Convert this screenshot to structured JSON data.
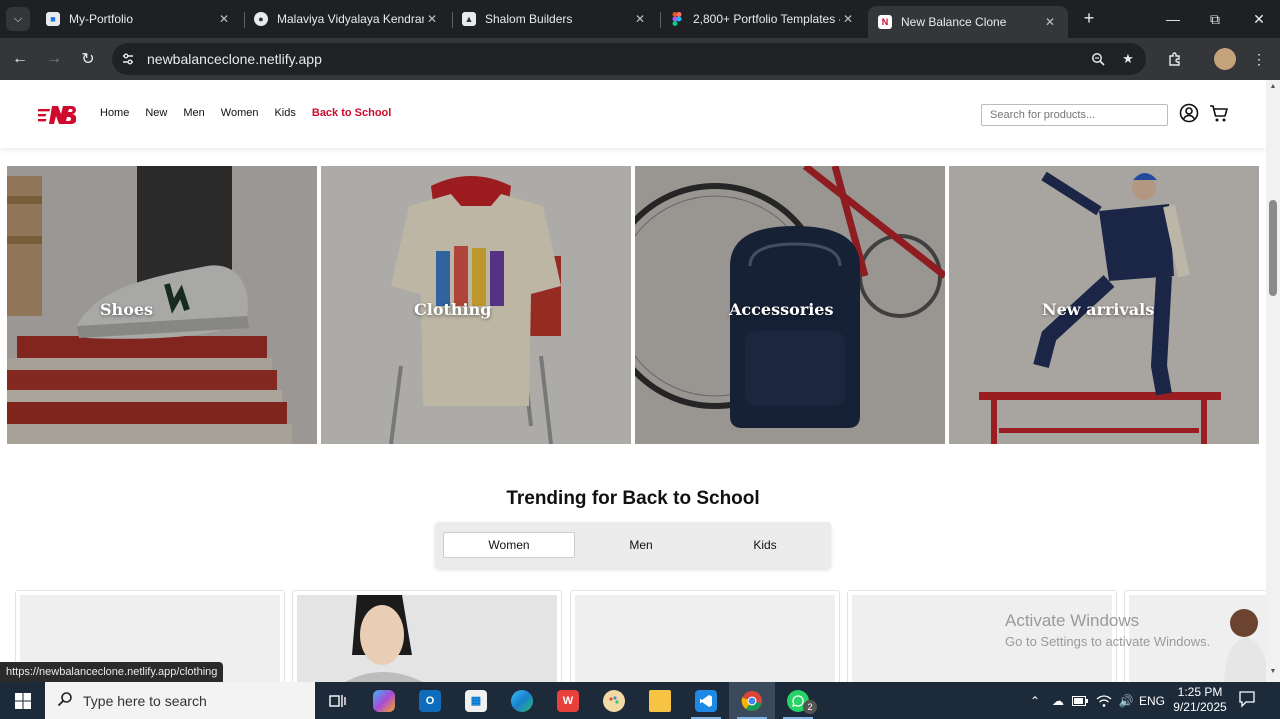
{
  "browser": {
    "tabs": [
      {
        "title": "My-Portfolio",
        "favicon": "doc-icon",
        "active": false
      },
      {
        "title": "Malaviya Vidyalaya Kendram",
        "favicon": "globe-icon",
        "active": false
      },
      {
        "title": "Shalom Builders",
        "favicon": "site-icon",
        "active": false
      },
      {
        "title": "2,800+ Portfolio Templates -",
        "favicon": "figma-icon",
        "active": false
      },
      {
        "title": "New Balance Clone",
        "favicon": "new-balance-icon",
        "active": true
      }
    ],
    "url": "newbalanceclone.netlify.app",
    "status_url": "https://newbalanceclone.netlify.app/clothing"
  },
  "site": {
    "nav": [
      "Home",
      "New",
      "Men",
      "Women",
      "Kids",
      "Back to School"
    ],
    "highlight_nav": "Back to School",
    "search_placeholder": "Search for products...",
    "categories": [
      "Shoes",
      "Clothing",
      "Accessories",
      "New arrivals"
    ],
    "trending_title": "Trending for Back to School",
    "trending_tabs": [
      "Women",
      "Men",
      "Kids"
    ],
    "active_trending_tab": "Women",
    "brand_color": "#cf0a2c"
  },
  "watermark": {
    "line1": "Activate Windows",
    "line2": "Go to Settings to activate Windows."
  },
  "taskbar": {
    "search_placeholder": "Type here to search",
    "whatsapp_badge": "2",
    "language": "ENG",
    "time": "1:25 PM",
    "date": "9/21/2025"
  }
}
